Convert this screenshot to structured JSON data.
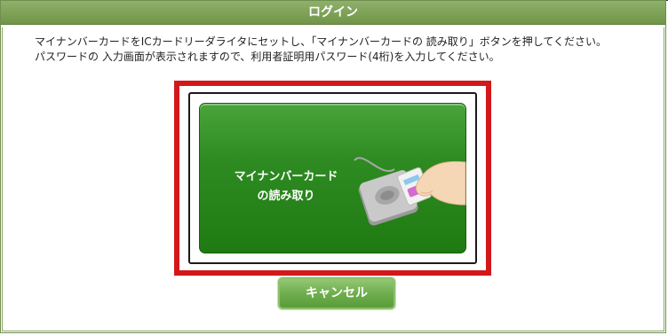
{
  "dialog": {
    "title": "ログイン"
  },
  "instructions": {
    "line1": "マイナンバーカードをICカードリーダライタにセットし、「マイナンバーカードの 読み取り」ボタンを押してください。",
    "line2": "パスワードの 入力画面が表示されますので、利用者証明用パスワード(4桁)を入力してください。"
  },
  "read_button": {
    "line1": "マイナンバーカード",
    "line2": "の読み取り"
  },
  "cancel_button": {
    "label": "キャンセル"
  },
  "colors": {
    "titlebar": "#7ea35a",
    "highlight": "#d2181b",
    "button_green": "#2e8b22",
    "cancel_green": "#6fae4e"
  },
  "icons": {
    "reader": "card-reader-with-hand-icon"
  }
}
